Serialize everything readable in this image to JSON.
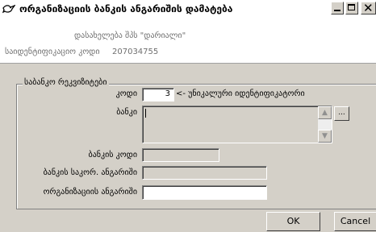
{
  "window": {
    "title": "ორგანიზაციის ბანკის ანგარიშის დამატება",
    "icon": "dove-app-icon"
  },
  "header": {
    "org_name": "დასახელება შპს \"დარიალი\"",
    "id_label": "საიდენტიფიკაციო კოდი",
    "id_value": "207034755"
  },
  "group": {
    "title": "საბანკო რეკვიზიტები",
    "code_label": "კოდი",
    "code_value": "3",
    "code_hint": "<- უნიკალური იდენტიფიკატორი",
    "bank_label": "ბანკი",
    "bank_value": "",
    "ellipsis_label": "...",
    "bank_code_label": "ბანკის კოდი",
    "bank_code_value": "",
    "bank_corr_label": "ბანკის საკორ. ანგარიში",
    "bank_corr_value": "",
    "org_account_label": "ორგანიზაციის ანგარიში",
    "org_account_value": ""
  },
  "buttons": {
    "ok": "OK",
    "cancel": "Cancel"
  }
}
